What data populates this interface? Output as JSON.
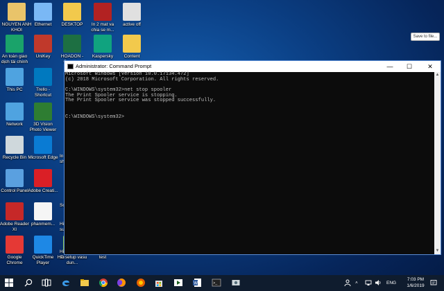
{
  "desktop": {
    "icons": [
      {
        "id": "nguyen",
        "label": "NGUYEN ANH KHOI",
        "icon": "user-folder-icon",
        "color": "#e9c46a"
      },
      {
        "id": "ethernet",
        "label": "Ethernet",
        "icon": "network-computer-icon",
        "color": "#7ab8f5"
      },
      {
        "id": "desktop",
        "label": "DESKTOP",
        "icon": "folder-icon",
        "color": "#f2c94c"
      },
      {
        "id": "in2mat",
        "label": "In 2 mat va chia se m...",
        "icon": "video-thumbnail-icon",
        "color": "#b22222"
      },
      {
        "id": "activeoff",
        "label": "active off",
        "icon": "settings-file-icon",
        "color": "#e0e0e0"
      },
      {
        "id": "antoangiao",
        "label": "An toàn giao dịch tài chính",
        "icon": "shield-green-icon",
        "color": "#1aa36a"
      },
      {
        "id": "unikey",
        "label": "UniKey",
        "icon": "unikey-icon",
        "color": "#c0392b"
      },
      {
        "id": "hoadon",
        "label": "HOADON - Copy.x...",
        "icon": "excel-icon",
        "color": "#1d6f42"
      },
      {
        "id": "kaspersky",
        "label": "Kaspersky Internet",
        "icon": "kaspersky-icon",
        "color": "#10a37f"
      },
      {
        "id": "content",
        "label": "Content",
        "icon": "folder-icon",
        "color": "#f2c94c"
      },
      {
        "id": "thispc",
        "label": "This PC",
        "icon": "computer-icon",
        "color": "#4fa3e0"
      },
      {
        "id": "trello",
        "label": "Trello - Shortcut",
        "icon": "trello-icon",
        "color": "#0079bf"
      },
      {
        "id": "network",
        "label": "Network",
        "icon": "network-globe-icon",
        "color": "#4fa3e0"
      },
      {
        "id": "3dvision",
        "label": "3D Vision Photo Viewer",
        "icon": "3d-vision-icon",
        "color": "#2e7d32"
      },
      {
        "id": "recyclebin",
        "label": "Recycle Bin",
        "icon": "recycle-bin-icon",
        "color": "#cfd8dc"
      },
      {
        "id": "edge",
        "label": "Microsoft Edge",
        "icon": "edge-icon",
        "color": "#0a7bd3"
      },
      {
        "id": "controlpanel",
        "label": "Control Panel",
        "icon": "control-panel-icon",
        "color": "#5aa0e0"
      },
      {
        "id": "adobecreative",
        "label": "Adobe Creati...",
        "icon": "adobe-cc-icon",
        "color": "#da1f26"
      },
      {
        "id": "adobereader",
        "label": "Adobe Reader XI",
        "icon": "pdf-icon",
        "color": "#c62828"
      },
      {
        "id": "phanmem",
        "label": "phanmem...",
        "icon": "text-file-icon",
        "color": "#f5f5f5"
      },
      {
        "id": "chrome",
        "label": "Google Chrome",
        "icon": "chrome-icon",
        "color": "#e53935"
      },
      {
        "id": "quicktime",
        "label": "QuickTime Player",
        "icon": "quicktime-icon",
        "color": "#1e88e5"
      },
      {
        "id": "hdsetup",
        "label": "HD setup vasu dun...",
        "icon": "video-thumbnail-icon",
        "color": "#8bc34a"
      },
      {
        "id": "test",
        "label": "test",
        "icon": "word-icon",
        "color": "#2b579a"
      }
    ],
    "partial_labels": [
      "In sh",
      "Sc",
      "Hi su",
      "Hi su"
    ]
  },
  "save_to_file": "Save to file...",
  "cmd": {
    "title": "Administrator: Command Prompt",
    "lines": [
      "Microsoft Windows [Version 10.0.17134.472]",
      "(c) 2018 Microsoft Corporation. All rights reserved.",
      "",
      "C:\\WINDOWS\\system32>net stop spooler",
      "The Print Spooler service is stopping.",
      "The Print Spooler service was stopped successfully.",
      "",
      "",
      "C:\\WINDOWS\\system32>"
    ]
  },
  "taskbar": {
    "language": "ENG",
    "time": "7:03 PM",
    "date": "1/6/2019"
  }
}
